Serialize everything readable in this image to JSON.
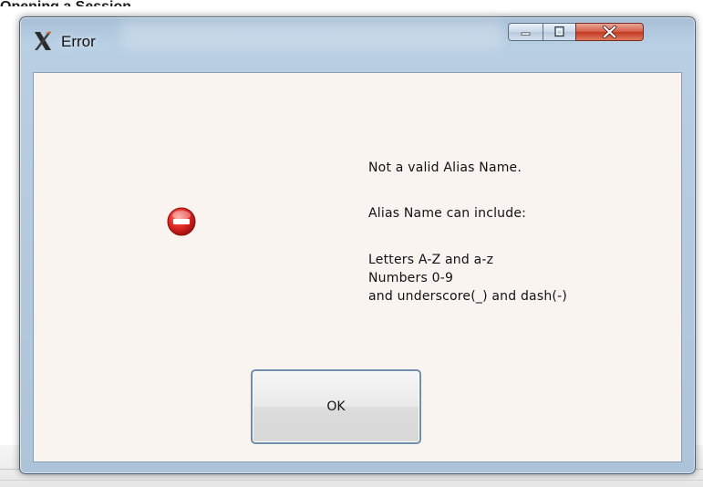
{
  "background": {
    "window_title": "Opening a Session"
  },
  "dialog": {
    "title": "Error",
    "icon": "x-app-icon",
    "controls": {
      "minimize": "minimize-icon",
      "maximize": "maximize-icon",
      "close": "close-icon"
    },
    "message": {
      "icon": "error-stop-icon",
      "line1": "Not a valid Alias Name.",
      "line2": "Alias Name can include:",
      "line3": "Letters A-Z and a-z",
      "line4": "Numbers 0-9",
      "line5": "and  underscore(_) and dash(-)"
    },
    "ok_label": "OK"
  },
  "colors": {
    "client_bg": "#f9f4f0",
    "frame": "#b8cfe4",
    "close_button": "#c23a22",
    "error_icon": "#d21d1d"
  }
}
